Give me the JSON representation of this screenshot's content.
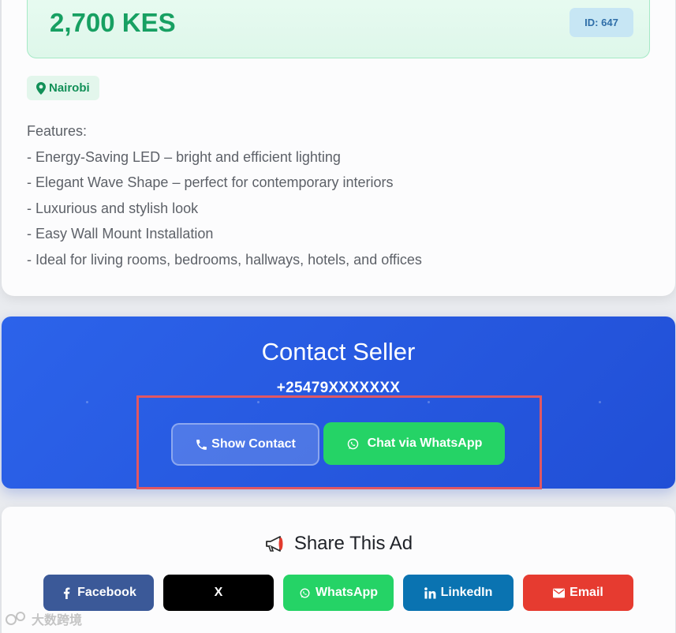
{
  "listing": {
    "price": "2,700 KES",
    "id_badge": "ID: 647",
    "location": "Nairobi",
    "description": [
      "Features:",
      "- Energy-Saving LED – bright and efficient lighting",
      "- Elegant Wave Shape – perfect for contemporary interiors",
      "- Luxurious and stylish look",
      "- Easy Wall Mount Installation",
      "- Ideal for living rooms, bedrooms, hallways, hotels, and offices"
    ]
  },
  "contact": {
    "title": "Contact Seller",
    "phone": "+25479XXXXXXX",
    "show_contact_label": "Show Contact",
    "whatsapp_label": "Chat via WhatsApp"
  },
  "share": {
    "title": "Share This Ad",
    "buttons": [
      {
        "label": "Facebook",
        "icon": "facebook-icon"
      },
      {
        "label": "X",
        "icon": "x-icon"
      },
      {
        "label": "WhatsApp",
        "icon": "whatsapp-icon"
      },
      {
        "label": "LinkedIn",
        "icon": "linkedin-icon"
      },
      {
        "label": "Email",
        "icon": "envelope-icon"
      }
    ]
  },
  "watermark": "大数跨境",
  "colors": {
    "price_green": "#17a062",
    "contact_blue": "#2c63ea",
    "whatsapp_green": "#25d366",
    "facebook_blue": "#3b5998",
    "linkedin_blue": "#0a73b1",
    "email_red": "#e63b30",
    "highlight_red": "#e15763"
  }
}
